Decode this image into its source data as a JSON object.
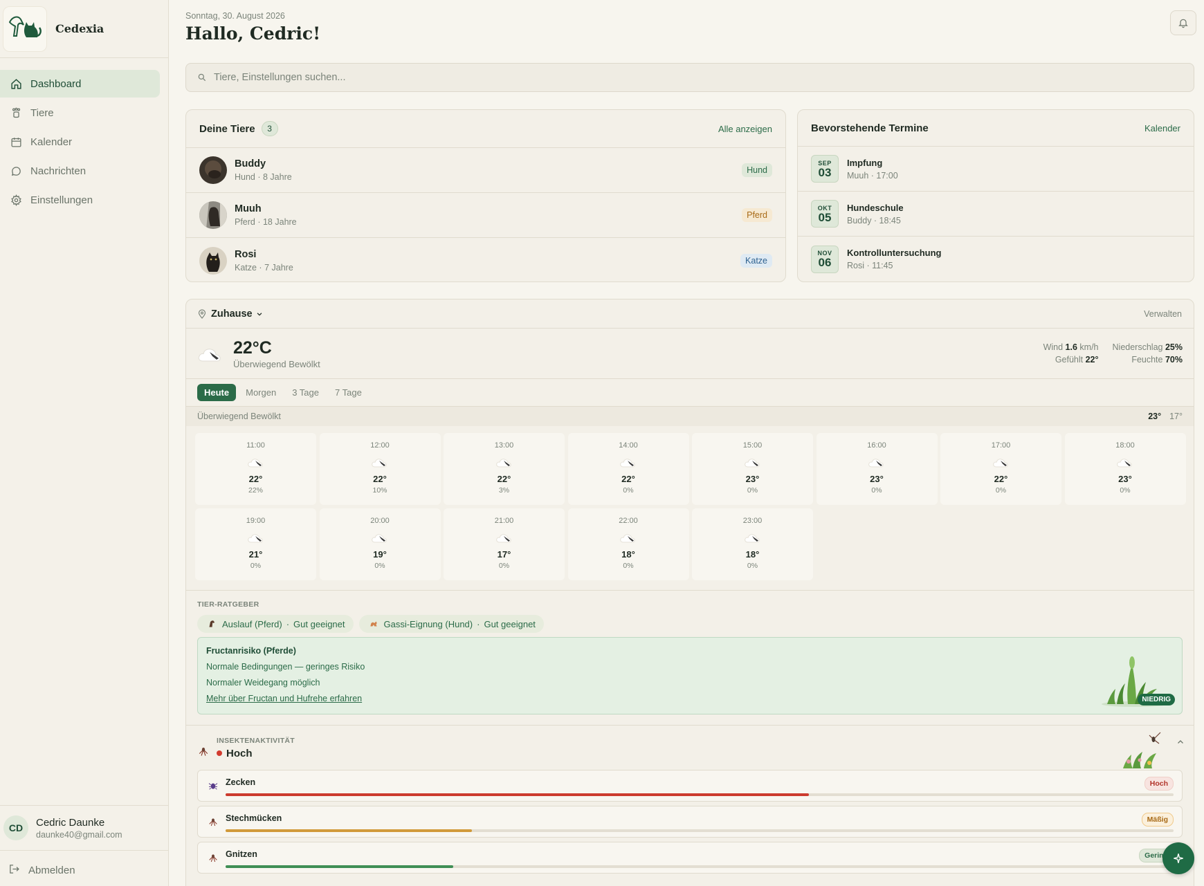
{
  "brand": {
    "name": "Cedexia"
  },
  "nav": [
    {
      "label": "Dashboard",
      "icon": "home-icon",
      "active": true
    },
    {
      "label": "Tiere",
      "icon": "paw-icon"
    },
    {
      "label": "Kalender",
      "icon": "calendar-icon"
    },
    {
      "label": "Nachrichten",
      "icon": "chat-icon"
    },
    {
      "label": "Einstellungen",
      "icon": "gear-icon"
    }
  ],
  "user": {
    "initials": "CD",
    "name": "Cedric Daunke",
    "email": "daunke40@gmail.com",
    "logout_label": "Abmelden"
  },
  "header": {
    "date": "Sonntag, 30. August 2026",
    "greeting": "Hallo, Cedric!"
  },
  "search": {
    "placeholder": "Tiere, Einstellungen suchen..."
  },
  "pets": {
    "title": "Deine Tiere",
    "count": "3",
    "link": "Alle anzeigen",
    "items": [
      {
        "name": "Buddy",
        "meta": "Hund · 8 Jahre",
        "tag": "Hund"
      },
      {
        "name": "Muuh",
        "meta": "Pferd · 18 Jahre",
        "tag": "Pferd"
      },
      {
        "name": "Rosi",
        "meta": "Katze · 7 Jahre",
        "tag": "Katze"
      }
    ]
  },
  "appointments": {
    "title": "Bevorstehende Termine",
    "link": "Kalender",
    "items": [
      {
        "month": "SEP",
        "day": "03",
        "title": "Impfung",
        "meta": "Muuh · 17:00"
      },
      {
        "month": "OKT",
        "day": "05",
        "title": "Hundeschule",
        "meta": "Buddy · 18:45"
      },
      {
        "month": "NOV",
        "day": "06",
        "title": "Kontrolluntersuchung",
        "meta": "Rosi · 11:45"
      }
    ]
  },
  "weather": {
    "location": "Zuhause",
    "manage": "Verwalten",
    "temp": "22°C",
    "condition": "Überwiegend Bewölkt",
    "stats": {
      "wind_label": "Wind",
      "wind_value": "1.6",
      "wind_unit": "km/h",
      "rain_label": "Niederschlag",
      "rain_value": "25%",
      "feels_label": "Gefühlt",
      "feels_value": "22°",
      "humidity_label": "Feuchte",
      "humidity_value": "70%"
    },
    "tabs": [
      "Heute",
      "Morgen",
      "3 Tage",
      "7 Tage"
    ],
    "day_condition": "Überwiegend Bewölkt",
    "day_high": "23°",
    "day_low": "17°",
    "hours": [
      {
        "time": "11:00",
        "temp": "22°",
        "rain": "22%"
      },
      {
        "time": "12:00",
        "temp": "22°",
        "rain": "10%"
      },
      {
        "time": "13:00",
        "temp": "22°",
        "rain": "3%"
      },
      {
        "time": "14:00",
        "temp": "22°",
        "rain": "0%"
      },
      {
        "time": "15:00",
        "temp": "23°",
        "rain": "0%"
      },
      {
        "time": "16:00",
        "temp": "23°",
        "rain": "0%"
      },
      {
        "time": "17:00",
        "temp": "22°",
        "rain": "0%"
      },
      {
        "time": "18:00",
        "temp": "23°",
        "rain": "0%"
      },
      {
        "time": "19:00",
        "temp": "21°",
        "rain": "0%"
      },
      {
        "time": "20:00",
        "temp": "19°",
        "rain": "0%"
      },
      {
        "time": "21:00",
        "temp": "17°",
        "rain": "0%"
      },
      {
        "time": "22:00",
        "temp": "18°",
        "rain": "0%"
      },
      {
        "time": "23:00",
        "temp": "18°",
        "rain": "0%"
      }
    ]
  },
  "advisor": {
    "label": "TIER-RATGEBER",
    "chips": [
      {
        "text": "Auslauf (Pferd)",
        "rating": "Gut geeignet"
      },
      {
        "text": "Gassi-Eignung (Hund)",
        "rating": "Gut geeignet"
      }
    ],
    "separator": "·",
    "fructan": {
      "title": "Fructanrisiko (Pferde)",
      "line1": "Normale Bedingungen — geringes Risiko",
      "line2": "Normaler Weidegang möglich",
      "link": "Mehr über Fructan und Hufrehe erfahren",
      "badge": "NIEDRIG"
    }
  },
  "insects": {
    "label": "INSEKTENAKTIVITÄT",
    "level": "Hoch",
    "items": [
      {
        "name": "Zecken",
        "level": "Hoch",
        "fill": 0.615,
        "color": "#cc3b2e"
      },
      {
        "name": "Stechmücken",
        "level": "Mäßig",
        "fill": 0.26,
        "color": "#d19a3a"
      },
      {
        "name": "Gnitzen",
        "level": "Gering",
        "fill": 0.24,
        "color": "#3f8f55"
      }
    ]
  },
  "colors": {
    "accent": "#2b6b48",
    "background": "#f7f5ee",
    "sidebar": "#f4f1e9"
  }
}
